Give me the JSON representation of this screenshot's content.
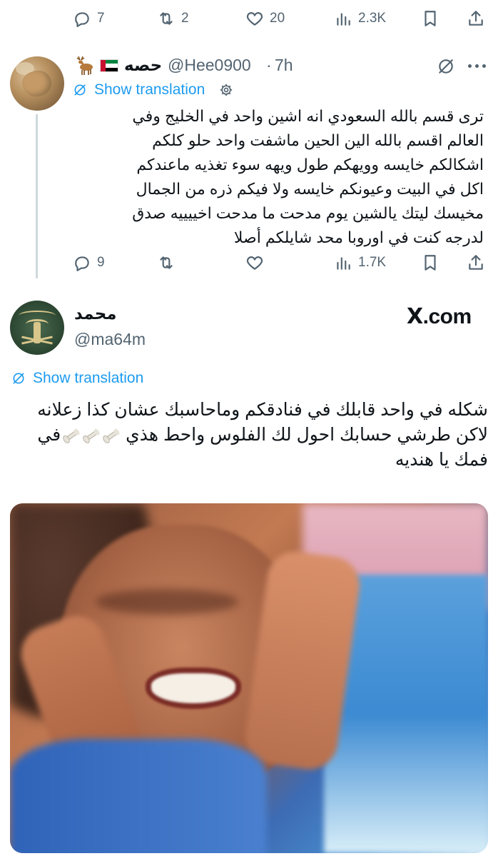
{
  "top_actions": {
    "replies": "7",
    "reposts": "2",
    "likes": "20",
    "views": "2.3K"
  },
  "tweet1": {
    "name": "حصه",
    "handle": "@Hee0900",
    "separator": "·",
    "time": "7h",
    "show_translation": "Show translation",
    "body_lines": [
      "ترى قسم بالله السعودي انه اشين واحد في الخليج وفي",
      "العالم اقسم بالله الين الحين ماشفت واحد حلو كلكم",
      "اشكالكم خايسه وويهكم طول ويهه سوء تغذيه ماعندكم",
      "اكل في البيت وعيونكم خايسه ولا فيكم ذره من الجمال",
      "مخيسك ليتك يالشين يوم مدحت ما مدحت اخييييه صدق",
      "لدرجه كنت في اوروبا محد شايلكم أصلا"
    ],
    "actions": {
      "replies": "9",
      "reposts": "",
      "likes": "",
      "views": "1.7K"
    }
  },
  "tweet2": {
    "name": "محمد",
    "handle": "@ma64m",
    "source_logo": {
      "x": "X",
      "rest": ".com"
    },
    "show_translation": "Show translation",
    "body_line1": "شكله في واحد قابلك في فنادقكم وماحاسبك عشان كذا زعلانه",
    "body_line2_a": "لاكن طرشي حسابك احول لك الفلوس واحط  هذي",
    "body_line2_b": "في",
    "body_line3": "فمك يا هنديه"
  },
  "colors": {
    "accent": "#1d9bf0",
    "muted": "#536471",
    "text": "#0f1419",
    "divider": "#cfd9de"
  }
}
